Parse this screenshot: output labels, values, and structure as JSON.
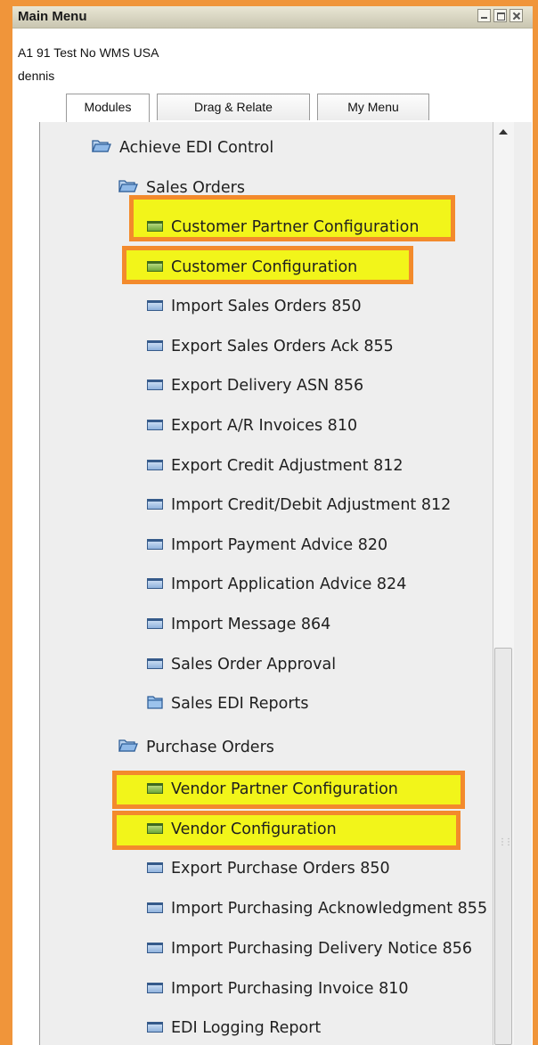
{
  "window": {
    "title": "Main Menu",
    "company": "A1 91 Test No WMS USA",
    "user": "dennis"
  },
  "tabs": [
    {
      "label": "Modules",
      "active": true
    },
    {
      "label": "Drag & Relate",
      "active": false
    },
    {
      "label": "My Menu",
      "active": false
    }
  ],
  "tree": {
    "root": {
      "label": "Achieve EDI Control",
      "icon": "open-folder-icon"
    },
    "sales": {
      "label": "Sales Orders",
      "icon": "open-folder-icon",
      "items": [
        {
          "label": "Customer Partner Configuration",
          "icon": "green-window-icon",
          "highlighted": true
        },
        {
          "label": "Customer Configuration",
          "icon": "green-window-icon",
          "highlighted": true
        },
        {
          "label": "Import Sales Orders 850",
          "icon": "window-icon"
        },
        {
          "label": "Export Sales Orders Ack 855",
          "icon": "window-icon"
        },
        {
          "label": "Export Delivery ASN 856",
          "icon": "window-icon"
        },
        {
          "label": "Export A/R Invoices 810",
          "icon": "window-icon"
        },
        {
          "label": "Export Credit Adjustment 812",
          "icon": "window-icon"
        },
        {
          "label": "Import Credit/Debit Adjustment 812",
          "icon": "window-icon"
        },
        {
          "label": "Import Payment Advice 820",
          "icon": "window-icon"
        },
        {
          "label": "Import Application Advice 824",
          "icon": "window-icon"
        },
        {
          "label": "Import Message 864",
          "icon": "window-icon"
        },
        {
          "label": "Sales Order Approval",
          "icon": "window-icon"
        },
        {
          "label": "Sales EDI Reports",
          "icon": "closed-folder-icon"
        }
      ]
    },
    "purchase": {
      "label": "Purchase Orders",
      "icon": "open-folder-icon",
      "items": [
        {
          "label": "Vendor Partner Configuration",
          "icon": "green-window-icon",
          "highlighted": true
        },
        {
          "label": "Vendor Configuration",
          "icon": "green-window-icon",
          "highlighted": true
        },
        {
          "label": "Export Purchase Orders 850",
          "icon": "window-icon"
        },
        {
          "label": "Import Purchasing Acknowledgment 855",
          "icon": "window-icon"
        },
        {
          "label": "Import Purchasing Delivery Notice 856",
          "icon": "window-icon"
        },
        {
          "label": "Import Purchasing Invoice 810",
          "icon": "window-icon"
        },
        {
          "label": "EDI Logging Report",
          "icon": "window-icon"
        }
      ]
    }
  },
  "colors": {
    "highlight_fill": "#f2f51a",
    "highlight_border": "#f38a2c",
    "frame": "#f0953a"
  }
}
